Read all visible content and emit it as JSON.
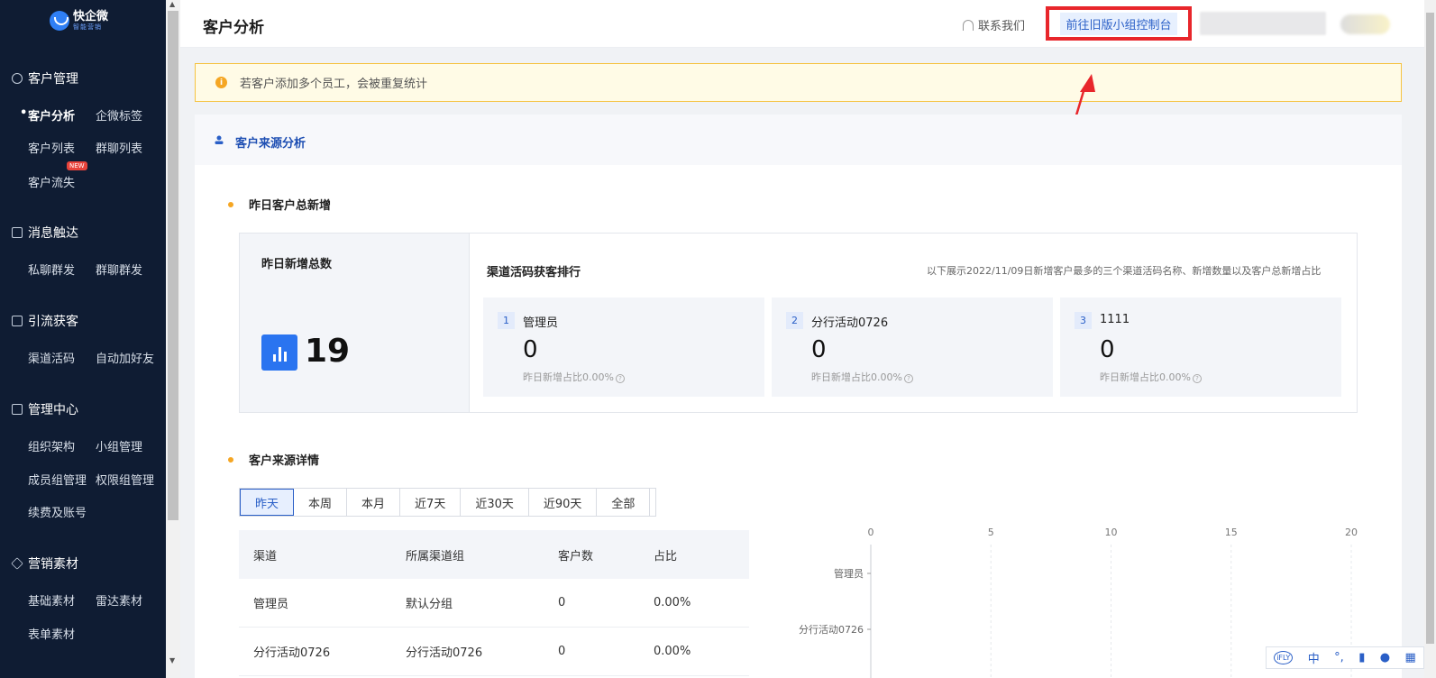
{
  "app": {
    "logo_title": "快企微",
    "logo_sub": "智能营销"
  },
  "sidebar": {
    "sections": [
      {
        "label": "客户管理",
        "icon": "person-icon"
      },
      {
        "label": "消息触达",
        "icon": "clipboard-icon"
      },
      {
        "label": "引流获客",
        "icon": "chart-icon"
      },
      {
        "label": "管理中心",
        "icon": "grid-icon"
      },
      {
        "label": "营销素材",
        "icon": "layers-icon"
      }
    ],
    "items": {
      "customer_analysis": "客户分析",
      "wecom_tags": "企微标签",
      "customer_list": "客户列表",
      "group_list": "群聊列表",
      "customer_churn": "客户流失",
      "new_badge": "NEW",
      "private_broadcast": "私聊群发",
      "group_broadcast": "群聊群发",
      "channel_qrcode": "渠道活码",
      "auto_add_friend": "自动加好友",
      "org_structure": "组织架构",
      "team_manage": "小组管理",
      "member_group_manage": "成员组管理",
      "permission_group_manage": "权限组管理",
      "renewal_account": "续费及账号",
      "basic_material": "基础素材",
      "radar_material": "雷达素材",
      "form_material": "表单素材"
    }
  },
  "header": {
    "title": "客户分析",
    "contact": "联系我们",
    "old_console": "前往旧版小组控制台"
  },
  "notice": {
    "text": "若客户添加多个员工，会被重复统计"
  },
  "panel": {
    "title": "客户来源分析",
    "yesterday_title": "昨日客户总新增",
    "total_label": "昨日新增总数",
    "total_value": "19",
    "rank_title": "渠道活码获客排行",
    "rank_note": "以下展示2022/11/09日新增客户最多的三个渠道活码名称、新增数量以及客户总新增占比",
    "ranks": [
      {
        "no": "1",
        "name": "管理员",
        "value": "0",
        "pct": "昨日新增占比0.00%"
      },
      {
        "no": "2",
        "name": "分行活动0726",
        "value": "0",
        "pct": "昨日新增占比0.00%"
      },
      {
        "no": "3",
        "name": "1111",
        "value": "0",
        "pct": "昨日新增占比0.00%"
      }
    ],
    "detail_title": "客户来源详情",
    "tabs": [
      "昨天",
      "本周",
      "本月",
      "近7天",
      "近30天",
      "近90天",
      "全部"
    ],
    "table": {
      "headers": [
        "渠道",
        "所属渠道组",
        "客户数",
        "占比"
      ],
      "rows": [
        [
          "管理员",
          "默认分组",
          "0",
          "0.00%"
        ],
        [
          "分行活动0726",
          "分行活动0726",
          "0",
          "0.00%"
        ]
      ]
    }
  },
  "chart_data": {
    "type": "bar",
    "orientation": "horizontal",
    "categories": [
      "管理员",
      "分行活动0726"
    ],
    "values": [
      0,
      0
    ],
    "xlim": [
      0,
      20
    ],
    "xticks": [
      "0",
      "5",
      "10",
      "15",
      "20"
    ],
    "grid": true
  },
  "ime": {
    "brand": "iFLY",
    "lang": "中"
  }
}
